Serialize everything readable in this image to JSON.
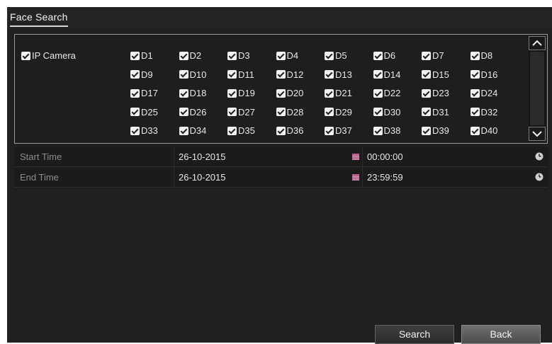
{
  "title": "Face Search",
  "camera_group": {
    "label": "IP Camera",
    "checked": true,
    "channels": [
      "D1",
      "D2",
      "D3",
      "D4",
      "D5",
      "D6",
      "D7",
      "D8",
      "D9",
      "D10",
      "D11",
      "D12",
      "D13",
      "D14",
      "D15",
      "D16",
      "D17",
      "D18",
      "D19",
      "D20",
      "D21",
      "D22",
      "D23",
      "D24",
      "D25",
      "D26",
      "D27",
      "D28",
      "D29",
      "D30",
      "D31",
      "D32",
      "D33",
      "D34",
      "D35",
      "D36",
      "D37",
      "D38",
      "D39",
      "D40"
    ]
  },
  "start_time": {
    "label": "Start Time",
    "date": "26-10-2015",
    "time": "00:00:00"
  },
  "end_time": {
    "label": "End Time",
    "date": "26-10-2015",
    "time": "23:59:59"
  },
  "buttons": {
    "search": "Search",
    "back": "Back"
  },
  "colors": {
    "background": "#202020",
    "panel_border": "#9a9a9a",
    "label_text": "#8c8c8c",
    "value_text": "#e6e6e6",
    "calendar_icon": "#d88ab0"
  },
  "icons": [
    "checkbox-checked-icon",
    "chevron-up-icon",
    "chevron-down-icon",
    "calendar-icon",
    "clock-icon"
  ]
}
